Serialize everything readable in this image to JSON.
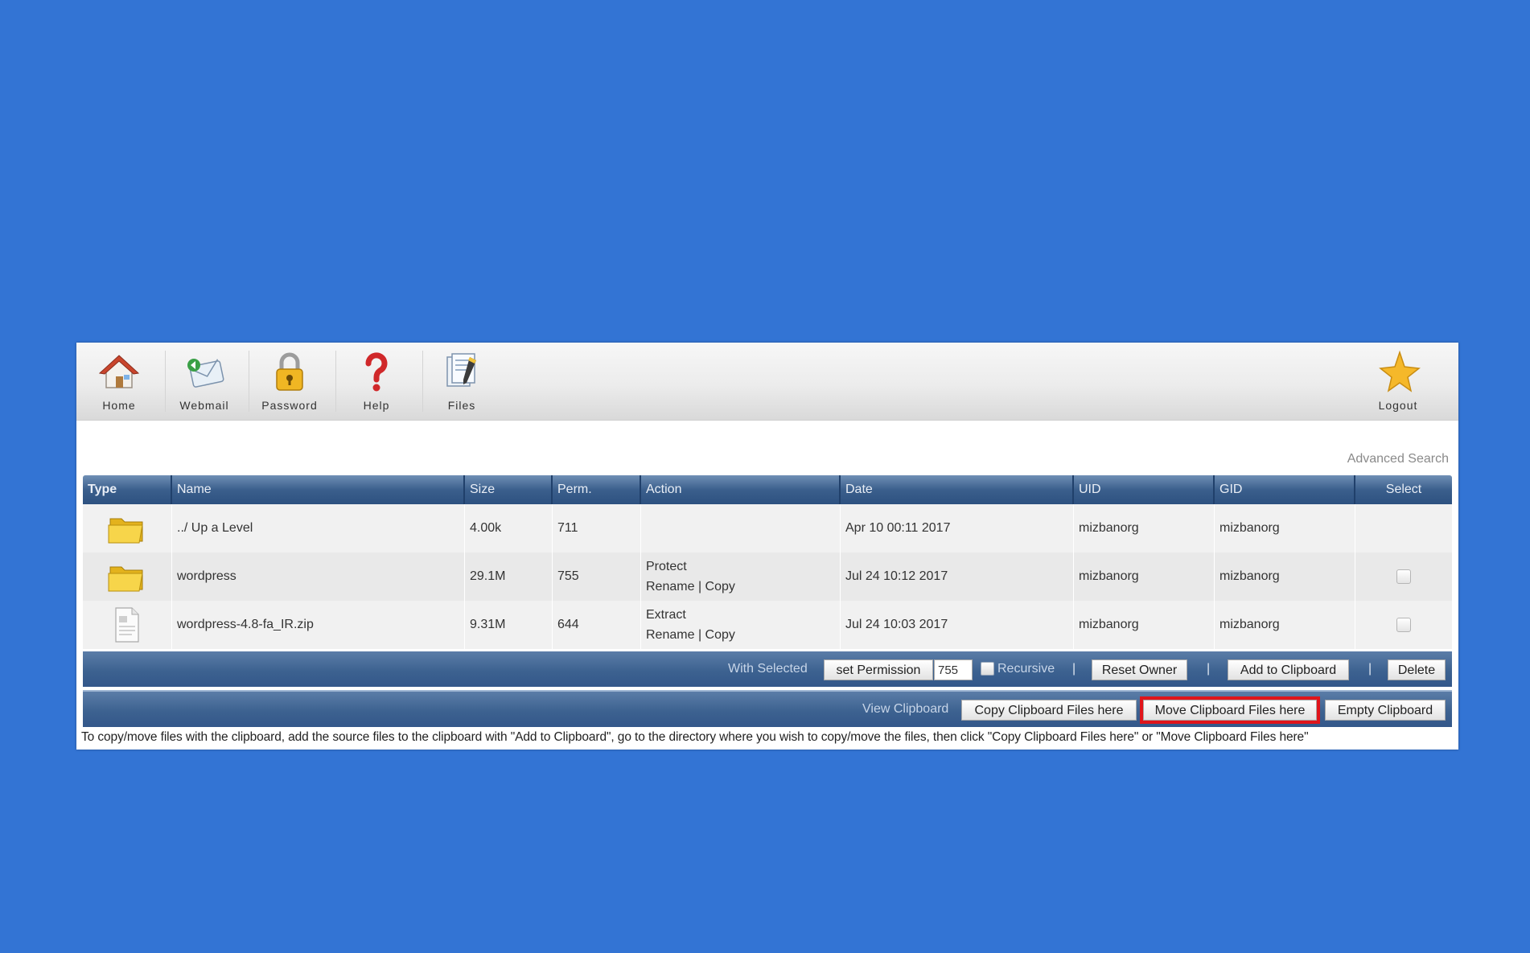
{
  "toolbar": {
    "home": "Home",
    "webmail": "Webmail",
    "password": "Password",
    "help": "Help",
    "files": "Files",
    "logout": "Logout"
  },
  "advanced_search": "Advanced Search",
  "table": {
    "headers": {
      "type": "Type",
      "name": "Name",
      "size": "Size",
      "perm": "Perm.",
      "action": "Action",
      "date": "Date",
      "uid": "UID",
      "gid": "GID",
      "select": "Select"
    },
    "rows": [
      {
        "icon": "folder-icon",
        "name": "../ Up a Level",
        "size": "4.00k",
        "perm": "711",
        "action1": "",
        "action2": "",
        "action3": "",
        "date": "Apr 10 00:11 2017",
        "uid": "mizbanorg",
        "gid": "mizbanorg"
      },
      {
        "icon": "folder-icon",
        "name": "wordpress",
        "size": "29.1M",
        "perm": "755",
        "action1": "Protect",
        "action2": "Rename",
        "action3": "Copy",
        "date": "Jul 24 10:12 2017",
        "uid": "mizbanorg",
        "gid": "mizbanorg"
      },
      {
        "icon": "file-icon",
        "name": "wordpress-4.8-fa_IR.zip",
        "size": "9.31M",
        "perm": "644",
        "action1": "Extract",
        "action2": "Rename",
        "action3": "Copy",
        "date": "Jul 24 10:03 2017",
        "uid": "mizbanorg",
        "gid": "mizbanorg"
      }
    ]
  },
  "actions": {
    "with_selected": "With Selected",
    "set_permission": "set Permission",
    "perm_value": "755",
    "recursive": "Recursive",
    "reset_owner": "Reset Owner",
    "add_to_clipboard": "Add to Clipboard",
    "delete": "Delete",
    "pipe": "|"
  },
  "clipboard": {
    "view": "View Clipboard",
    "copy_here": "Copy Clipboard Files here",
    "move_here": "Move Clipboard Files here",
    "empty": "Empty Clipboard"
  },
  "note": "To copy/move files with the clipboard, add the source files to the clipboard with \"Add to Clipboard\", go to the directory where you wish to copy/move the files, then click \"Copy Clipboard Files here\" or \"Move Clipboard Files here\"",
  "colors": {
    "background": "#3374d4",
    "header_bar": "#3b5f8c",
    "highlight": "#e0151b"
  }
}
